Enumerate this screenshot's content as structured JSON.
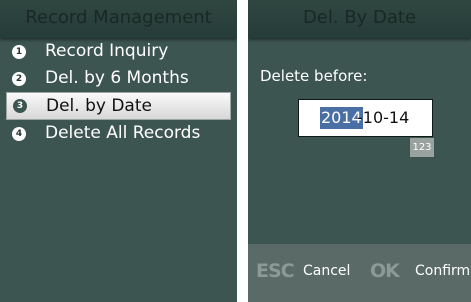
{
  "left_screen": {
    "title": "Record Management",
    "menu": [
      {
        "number": "1",
        "label": "Record Inquiry"
      },
      {
        "number": "2",
        "label": "Del. by 6 Months"
      },
      {
        "number": "3",
        "label": "Del. by Date",
        "selected": true
      },
      {
        "number": "4",
        "label": "Delete All Records"
      }
    ]
  },
  "right_screen": {
    "title": "Del. By Date",
    "prompt": "Delete before:",
    "date_year": "2014",
    "date_rest": "-10-14",
    "input_mode": "123",
    "softkeys": {
      "esc_key": "ESC",
      "cancel_label": "Cancel",
      "ok_key": "OK",
      "confirm_label": "Confirm"
    }
  },
  "colors": {
    "screen_bg": "#3d5551",
    "selection_bg": "#f0f0f0",
    "text_highlight": "#4a6fa4",
    "softkey_bar": "#5a6a67"
  }
}
